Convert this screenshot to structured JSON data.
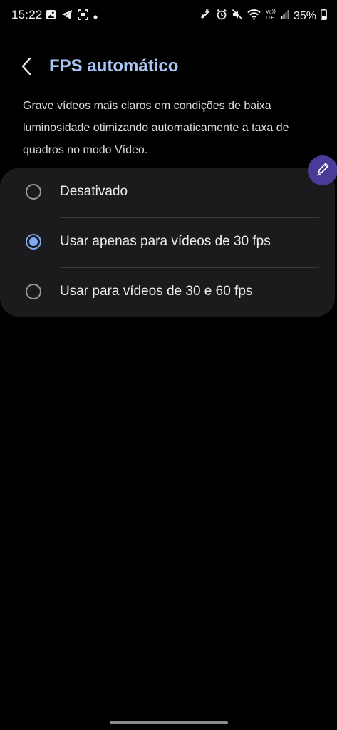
{
  "status_bar": {
    "time": "15:22",
    "battery": "35%",
    "left_icons": [
      "gallery-icon",
      "telegram-icon",
      "screenshot-icon",
      "dot-icon"
    ],
    "right_icons": [
      "sleep-icon",
      "alarm-icon",
      "mute-icon",
      "wifi-icon",
      "volte-icon",
      "signal-icon",
      "battery-icon"
    ]
  },
  "header": {
    "title": "FPS automático"
  },
  "description": "Grave vídeos mais claros em condições de baixa luminosidade otimizando automaticamente a taxa de quadros no modo Vídeo.",
  "options": [
    {
      "label": "Desativado",
      "selected": false
    },
    {
      "label": "Usar apenas para vídeos de 30 fps",
      "selected": true
    },
    {
      "label": "Usar para vídeos de 30 e 60 fps",
      "selected": false
    }
  ],
  "colors": {
    "accent": "#7fa9f1",
    "title": "#a9c6f5",
    "card_background": "#1b1b1d",
    "fab": "#4b3a97",
    "background": "#000000"
  }
}
